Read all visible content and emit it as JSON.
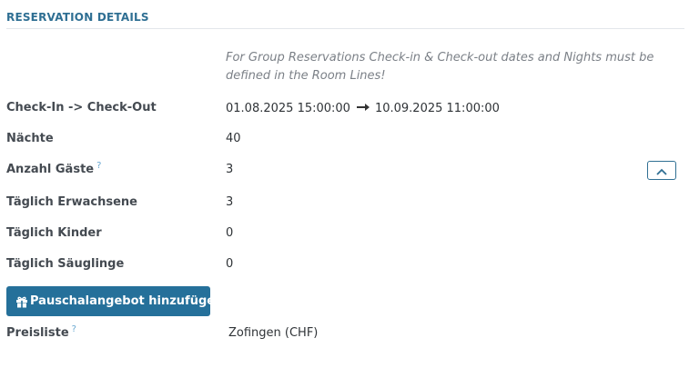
{
  "section": {
    "title": "RESERVATION DETAILS",
    "note": "For Group Reservations Check-in & Check-out dates and Nights must be defined in the Room Lines!"
  },
  "fields": {
    "checkin_checkout": {
      "label": "Check-In -> Check-Out",
      "checkin": "01.08.2025 15:00:00",
      "checkout": "10.09.2025 11:00:00",
      "arrow_icon": "arrow-right-icon"
    },
    "naechte": {
      "label": "Nächte",
      "value": "40"
    },
    "anzahl_gaeste": {
      "label": "Anzahl Gäste",
      "help": "?",
      "value": "3"
    },
    "erwachsene": {
      "label": "Täglich Erwachsene",
      "value": "3"
    },
    "kinder": {
      "label": "Täglich Kinder",
      "value": "0"
    },
    "saeuglinge": {
      "label": "Täglich Säuglinge",
      "value": "0"
    },
    "preisliste": {
      "label": "Preisliste",
      "help": "?",
      "value": "Zofingen (CHF)"
    }
  },
  "actions": {
    "add_package_label": "Pauschalangebot hinzufügen",
    "add_package_icon": "gift-icon",
    "collapse_icon": "chevron-up-icon"
  },
  "colors": {
    "accent": "#2f6f93",
    "button_bg": "#25709a",
    "help": "#6aa8d1",
    "note": "#7b8087"
  }
}
